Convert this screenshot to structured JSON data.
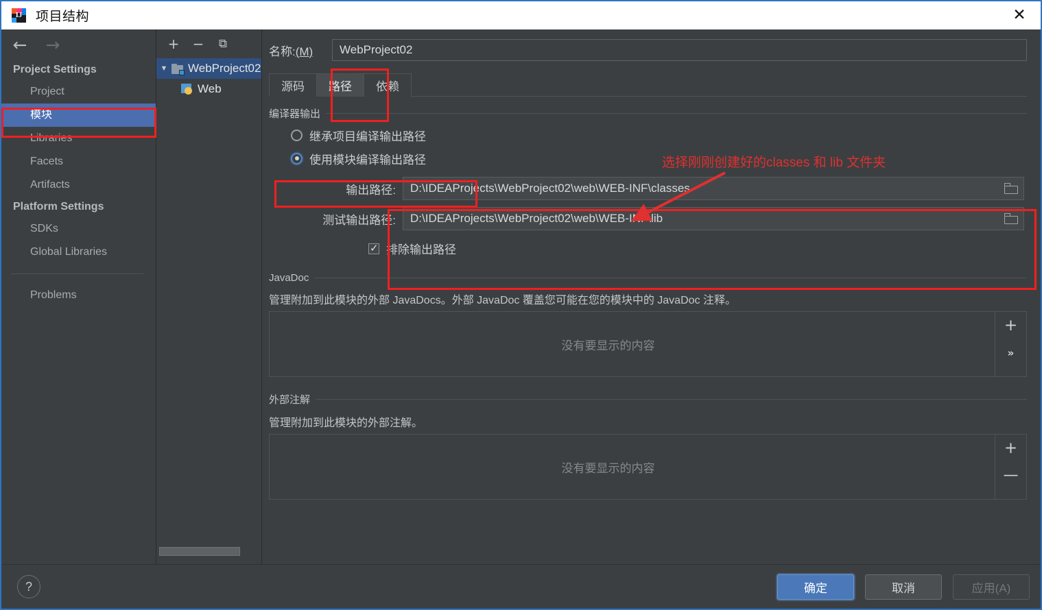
{
  "window": {
    "title": "项目结构",
    "close_label": "✕",
    "app_icon": "intellij-idea-icon"
  },
  "sidebar": {
    "nav_back": "←",
    "nav_forward": "→",
    "groups": [
      {
        "label": "Project Settings",
        "items": [
          {
            "label": "Project",
            "selected": false
          },
          {
            "label": "模块",
            "selected": true
          },
          {
            "label": "Libraries",
            "selected": false
          },
          {
            "label": "Facets",
            "selected": false
          },
          {
            "label": "Artifacts",
            "selected": false
          }
        ]
      },
      {
        "label": "Platform Settings",
        "items": [
          {
            "label": "SDKs",
            "selected": false
          },
          {
            "label": "Global Libraries",
            "selected": false
          }
        ]
      }
    ],
    "extra_items": [
      {
        "label": "Problems"
      }
    ]
  },
  "tree": {
    "toolbar": {
      "add": "+",
      "remove": "−",
      "copy": "⧉"
    },
    "nodes": [
      {
        "label": "WebProject02",
        "twisty": "▼",
        "icon": "module-folder-icon",
        "selected": true,
        "level": 0
      },
      {
        "label": "Web",
        "icon": "web-facet-icon",
        "selected": false,
        "level": 1
      }
    ]
  },
  "main": {
    "name_label": "名称:(M)",
    "name_value": "WebProject02",
    "tabs": [
      {
        "label": "源码",
        "active": false
      },
      {
        "label": "路径",
        "active": true
      },
      {
        "label": "依赖",
        "active": false
      }
    ],
    "compiler_output": {
      "section_title": "编译器输出",
      "radio_inherit": "继承项目编译输出路径",
      "radio_module": "使用模块编译输出路径",
      "selected_radio": "module",
      "output_path_label": "输出路径:",
      "output_path_value": "D:\\IDEAProjects\\WebProject02\\web\\WEB-INF\\classes",
      "test_output_path_label": "测试输出路径:",
      "test_output_path_value": "D:\\IDEAProjects\\WebProject02\\web\\WEB-INF\\lib",
      "exclude_label": "排除输出路径",
      "exclude_checked": true,
      "browse_icon": "folder-browse-icon"
    },
    "javadoc": {
      "section_title": "JavaDoc",
      "description": "管理附加到此模块的外部 JavaDocs。外部 JavaDoc 覆盖您可能在您的模块中的 JavaDoc 注释。",
      "empty_text": "没有要显示的内容",
      "add_btn": "+",
      "more_btn": "»"
    },
    "external_annotations": {
      "section_title": "外部注解",
      "description": "管理附加到此模块的外部注解。",
      "empty_text": "没有要显示的内容",
      "add_btn": "+",
      "remove_btn": "—"
    }
  },
  "annotation": {
    "text": "选择刚刚创建好的classes 和 lib 文件夹",
    "color": "#e03030"
  },
  "footer": {
    "help_label": "?",
    "ok_label": "确定",
    "cancel_label": "取消",
    "apply_label": "应用(A)"
  },
  "colors": {
    "accent_blue": "#4b6eaf",
    "annotation_red": "#f02020",
    "panel_bg": "#3c3f41",
    "title_bg": "#ffffff"
  }
}
